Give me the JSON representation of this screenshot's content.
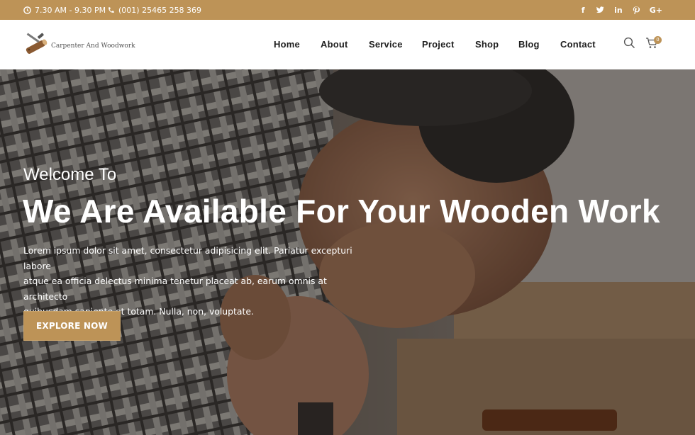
{
  "topbar": {
    "hours": "7.30 AM - 9.30 PM",
    "phone": "(001) 25465 258 369",
    "social": [
      {
        "icon": "facebook-icon",
        "glyph": "f"
      },
      {
        "icon": "twitter-icon",
        "glyph": "t"
      },
      {
        "icon": "linkedin-icon",
        "glyph": "in"
      },
      {
        "icon": "pinterest-icon",
        "glyph": "p"
      },
      {
        "icon": "google-plus-icon",
        "glyph": "G+"
      }
    ]
  },
  "header": {
    "logo_text": "Carpenter And Woodwork",
    "nav": [
      "Home",
      "About",
      "Service",
      "Project",
      "Shop",
      "Blog",
      "Contact"
    ],
    "search_icon": "search-icon",
    "cart_icon": "cart-icon",
    "cart_count": "0"
  },
  "hero": {
    "welcome": "Welcome To",
    "headline": "We Are Available For Your Wooden Work",
    "description_lines": [
      "Lorem ipsum dolor sit amet, consectetur adipisicing elit. Pariatur excepturi labore",
      "atque ea officia delectus minima tenetur placeat ab, earum omnis at architecto",
      "quibusdam sapiente et totam. Nulla, non, voluptate."
    ],
    "button": "EXPLORE NOW"
  },
  "colors": {
    "accent": "#bd9357",
    "header_bg": "#ffffff",
    "nav_text": "#1f1f1f"
  }
}
